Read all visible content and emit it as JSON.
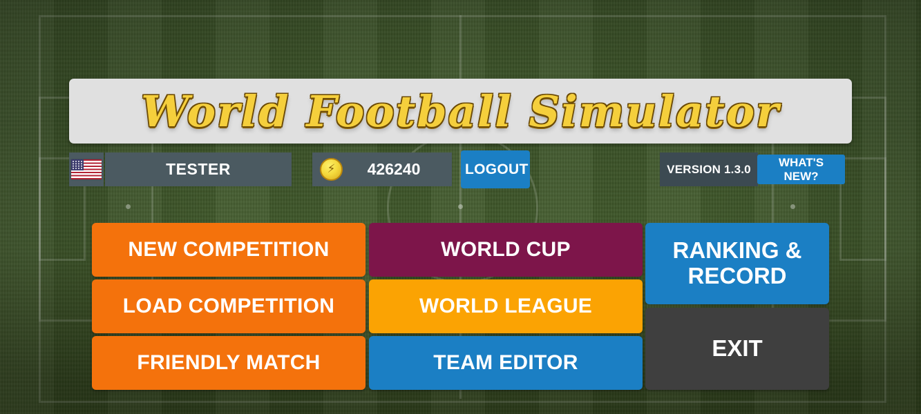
{
  "app": {
    "title": "World Football Simulator"
  },
  "info_bar": {
    "flag_icon": "us-flag-icon",
    "player_name": "TESTER",
    "coin_icon": "coin-icon",
    "coin_amount": "426240",
    "logout_label": "LOGOUT",
    "version_label": "VERSION 1.3.0",
    "whats_new_label": "WHAT'S NEW?"
  },
  "menu": {
    "new_competition": "NEW COMPETITION",
    "load_competition": "LOAD COMPETITION",
    "friendly_match": "FRIENDLY MATCH",
    "world_cup": "WORLD CUP",
    "world_league": "WORLD LEAGUE",
    "team_editor": "TEAM EDITOR",
    "ranking_record": "RANKING & RECORD",
    "exit": "EXIT"
  },
  "colors": {
    "orange": "#f4720c",
    "maroon": "#7d154a",
    "amber": "#fba303",
    "blue": "#1b7fc4",
    "gray": "#3f3f3f",
    "title_gold": "#f5cf3c",
    "panel": "#e0e0e0",
    "info_panel": "#4b5a61"
  }
}
